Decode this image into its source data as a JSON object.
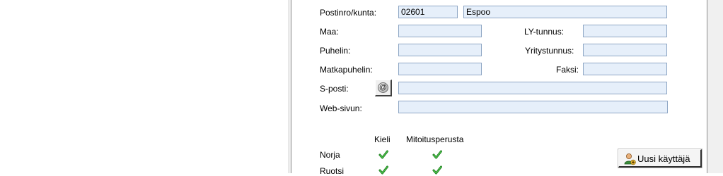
{
  "form": {
    "postinro_label": "Postinro/kunta:",
    "postinro_value": "02601",
    "kunta_value": "Espoo",
    "maa_label": "Maa:",
    "maa_value": "",
    "lytunnus_label": "LY-tunnus:",
    "lytunnus_value": "",
    "puhelin_label": "Puhelin:",
    "puhelin_value": "",
    "yritystunnus_label": "Yritystunnus:",
    "yritystunnus_value": "",
    "matkapuhelin_label": "Matkapuhelin:",
    "matkapuhelin_value": "",
    "faksi_label": "Faksi:",
    "faksi_value": "",
    "sposti_label": "S-posti:",
    "sposti_value": "",
    "websivu_label": "Web-sivun:",
    "websivu_value": ""
  },
  "languages": {
    "col_kieli": "Kieli",
    "col_mitoitusperusta": "Mitoitusperusta",
    "rows": [
      {
        "name": "Norja",
        "kieli": true,
        "mitoitusperusta": true
      },
      {
        "name": "Ruotsi",
        "kieli": true,
        "mitoitusperusta": true
      }
    ]
  },
  "buttons": {
    "new_user_label": "Uusi käyttäjä",
    "email_icon": "at-sign-icon"
  },
  "colors": {
    "input_bg": "#e6effa",
    "input_border": "#8ea6c4",
    "check_green": "#2e9e2e"
  }
}
